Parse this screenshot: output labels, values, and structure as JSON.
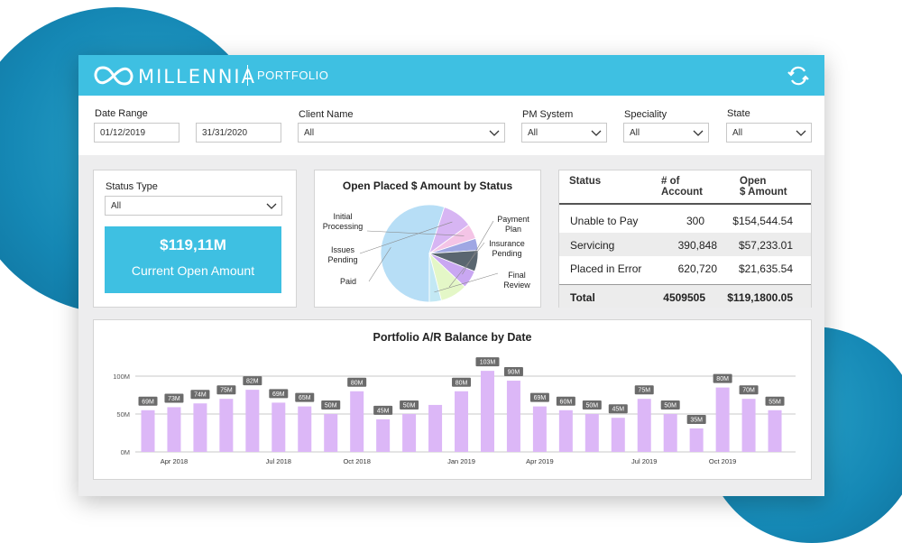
{
  "app": {
    "brand": "MILLENNIA",
    "section": "PORTFOLIO"
  },
  "colors": {
    "accent": "#3ec0e2",
    "bar": "#dcb7f7",
    "background_blob": "#1588b5"
  },
  "icons": {
    "logo": "infinity-logo-icon",
    "refresh": "refresh-icon",
    "chevron": "chevron-down-icon"
  },
  "filters": {
    "date_range": {
      "label": "Date Range",
      "from": "01/12/2019",
      "to": "31/31/2020"
    },
    "client_name": {
      "label": "Client Name",
      "value": "All"
    },
    "pm_system": {
      "label": "PM System",
      "value": "All"
    },
    "speciality": {
      "label": "Speciality",
      "value": "All"
    },
    "state": {
      "label": "State",
      "value": "All"
    }
  },
  "status_panel": {
    "label": "Status Type",
    "value": "All"
  },
  "kpi": {
    "value": "$119,11M",
    "label": "Current Open Amount"
  },
  "pie": {
    "title": "Open Placed $ Amount by Status",
    "slices": [
      {
        "label": "Paid",
        "value": 55,
        "color": "#b7def6"
      },
      {
        "label": "Issues Pending",
        "value": 10,
        "color": "#d7b5f3"
      },
      {
        "label": "Initial Processing",
        "value": 5,
        "color": "#f4c4e6"
      },
      {
        "label": "",
        "value": 4,
        "color": "#9fa7e3"
      },
      {
        "label": "",
        "value": 7,
        "color": "#5a6670"
      },
      {
        "label": "Payment Plan",
        "value": 6,
        "color": "#c9a7f2"
      },
      {
        "label": "Insurance Pending",
        "value": 9,
        "color": "#e4f7c7"
      },
      {
        "label": "Final Review",
        "value": 4,
        "color": "#c3e8f4"
      }
    ]
  },
  "table": {
    "headers": {
      "status": "Status",
      "accounts_l1": "# of",
      "accounts_l2": "Account",
      "amount_l1": "Open",
      "amount_l2": "$ Amount"
    },
    "rows": [
      {
        "status": "Unable to Pay",
        "accounts": "300",
        "amount": "$154,544.54"
      },
      {
        "status": "Servicing",
        "accounts": "390,848",
        "amount": "$57,233.01"
      },
      {
        "status": "Placed in Error",
        "accounts": "620,720",
        "amount": "$21,635.54"
      }
    ],
    "total": {
      "status": "Total",
      "accounts": "4509505",
      "amount": "$119,1800.05"
    }
  },
  "chart_data": {
    "type": "bar",
    "title": "Portfolio A/R Balance by Date",
    "ylim": [
      0,
      100
    ],
    "yticks": [
      "0M",
      "50M",
      "100M"
    ],
    "grid": true,
    "values": [
      55,
      59,
      64,
      70,
      82,
      65,
      60,
      50,
      80,
      43,
      50,
      62,
      80,
      107,
      94,
      60,
      55,
      50,
      45,
      70,
      50,
      31,
      85,
      70,
      55
    ],
    "labels": [
      "69M",
      "73M",
      "74M",
      "75M",
      "82M",
      "69M",
      "65M",
      "50M",
      "80M",
      "45M",
      "50M",
      "",
      "80M",
      "103M",
      "90M",
      "69M",
      "60M",
      "50M",
      "45M",
      "75M",
      "50M",
      "35M",
      "80M",
      "70M",
      "55M"
    ],
    "x_ticks": [
      {
        "index": 1,
        "label": "Apr 2018"
      },
      {
        "index": 5,
        "label": "Jul 2018"
      },
      {
        "index": 8,
        "label": "Oct 2018"
      },
      {
        "index": 12,
        "label": "Jan 2019"
      },
      {
        "index": 15,
        "label": "Apr 2019"
      },
      {
        "index": 19,
        "label": "Jul 2019"
      },
      {
        "index": 22,
        "label": "Oct 2019"
      }
    ]
  }
}
